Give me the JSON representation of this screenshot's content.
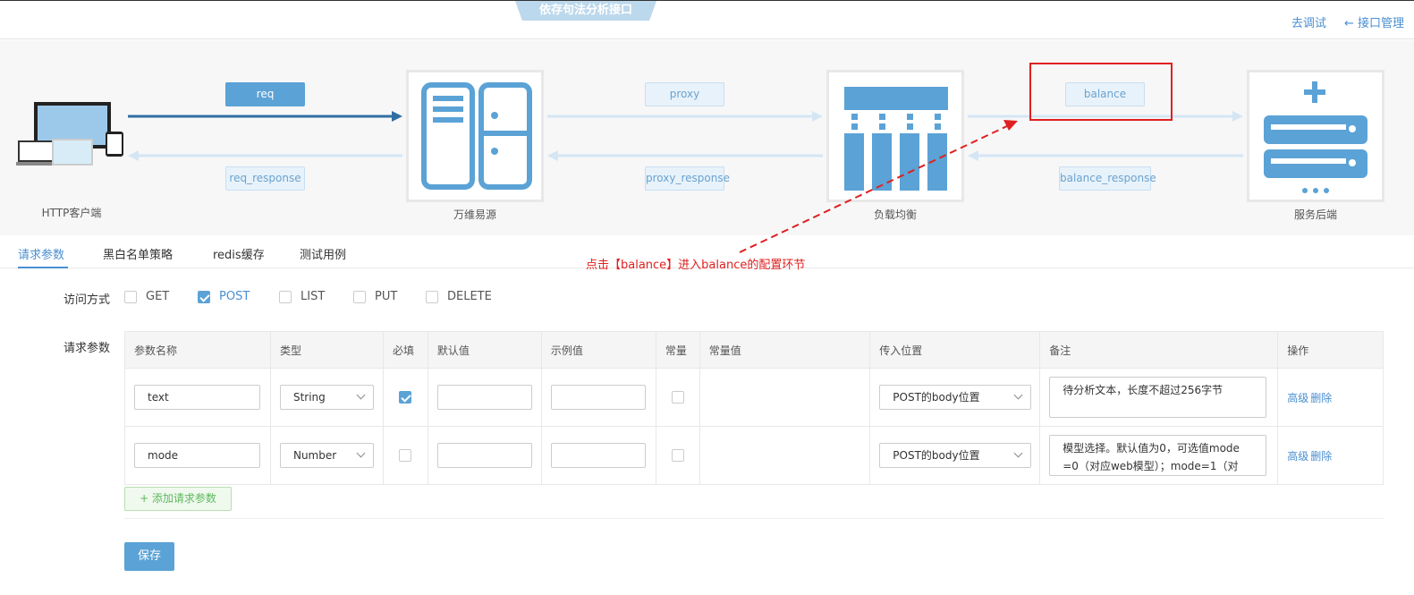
{
  "header": {
    "title": "依存句法分析接口",
    "debug_link": "去调试",
    "back_link": "← 接口管理"
  },
  "flow": {
    "nodes": {
      "client": "HTTP客户端",
      "wanwei": "万维易源",
      "balancer": "负载均衡",
      "backend": "服务后端"
    },
    "pills": {
      "req": "req",
      "req_response": "req_response",
      "proxy": "proxy",
      "proxy_response": "proxy_response",
      "balance": "balance",
      "balance_response": "balance_response"
    },
    "annotation": "点击【balance】进入balance的配置环节"
  },
  "tabs": [
    "请求参数",
    "黑白名单策略",
    "redis缓存",
    "测试用例"
  ],
  "form": {
    "method_label": "访问方式",
    "methods": [
      {
        "label": "GET",
        "checked": false
      },
      {
        "label": "POST",
        "checked": true
      },
      {
        "label": "LIST",
        "checked": false
      },
      {
        "label": "PUT",
        "checked": false
      },
      {
        "label": "DELETE",
        "checked": false
      }
    ],
    "params_label": "请求参数",
    "columns": [
      "参数名称",
      "类型",
      "必填",
      "默认值",
      "示例值",
      "常量",
      "常量值",
      "传入位置",
      "备注",
      "操作"
    ],
    "rows": [
      {
        "name": "text",
        "type": "String",
        "required": true,
        "position": "POST的body位置",
        "note": "待分析文本，长度不超过256字节",
        "op1": "高级",
        "op2": "删除"
      },
      {
        "name": "mode",
        "type": "Number",
        "required": false,
        "position": "POST的body位置",
        "note": "模型选择。默认值为0，可选值mode =0（对应web模型）；mode=1（对",
        "op1": "高级",
        "op2": "删除"
      }
    ],
    "add_button": "+ 添加请求参数",
    "save_button": "保存"
  },
  "colors": {
    "accent": "#5ba2d6",
    "annotation": "#e02020"
  }
}
